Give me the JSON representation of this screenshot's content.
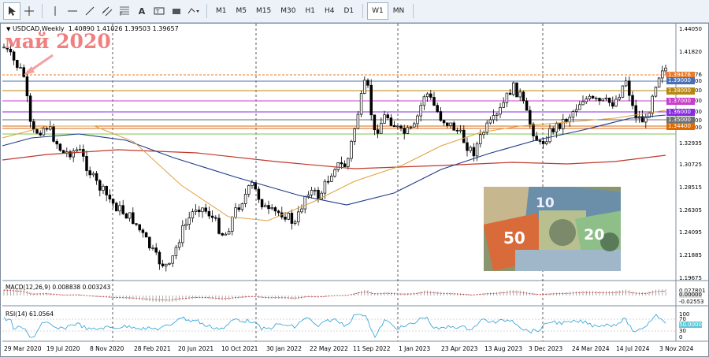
{
  "toolbar": {
    "timeframes": [
      "M1",
      "M5",
      "M15",
      "M30",
      "H1",
      "H4",
      "D1",
      "W1",
      "MN"
    ],
    "active_timeframe": "W1",
    "tool_icons": [
      "cursor-icon",
      "crosshair-icon",
      "vertical-line-icon",
      "horizontal-line-icon",
      "trendline-icon",
      "channel-icon",
      "fibonacci-icon",
      "text-icon",
      "label-icon",
      "rectangle-icon",
      "shapes-icon"
    ],
    "text_tool_label": "A"
  },
  "chart": {
    "symbol_line": "USDCAD,Weekly  1.40890 1.41026 1.39503 1.39657",
    "annotation": "май 2020",
    "price_axis": [
      "1.44050",
      "1.41820",
      "1.39476",
      "1.39000",
      "1.38000",
      "1.37000",
      "1.36000",
      "1.35000",
      "1.34400",
      "1.32935",
      "1.30725",
      "1.28515",
      "1.26305",
      "1.24095",
      "1.21885",
      "1.19675"
    ],
    "price_labels": [
      {
        "text": "1.39476",
        "color": "#e97c2a"
      },
      {
        "text": "1.39000",
        "color": "#4a6fb5"
      },
      {
        "text": "1.38000",
        "color": "#b8860b"
      },
      {
        "text": "1.37000",
        "color": "#c93fcb"
      },
      {
        "text": "1.36000",
        "color": "#8a2be2"
      },
      {
        "text": "1.35000",
        "color": "#707070"
      },
      {
        "text": "1.34400",
        "color": "#e06a00"
      }
    ],
    "date_axis": [
      "29 Mar 2020",
      "19 Jul 2020",
      "8 Nov 2020",
      "28 Feb 2021",
      "20 Jun 2021",
      "10 Oct 2021",
      "30 Jan 2022",
      "22 May 2022",
      "11 Sep 2022",
      "1 Jan 2023",
      "23 Apr 2023",
      "13 Aug 2023",
      "3 Dec 2023",
      "24 Mar 2024",
      "14 Jul 2024",
      "3 Nov 2024"
    ],
    "macd_label": "MACD(12,26,9) 0.008838 0.003243",
    "macd_axis": [
      "0.027801",
      "0.00000",
      "-0.02553"
    ],
    "rsi_label": "RSI(14) 61.0564",
    "rsi_axis": [
      "100",
      "70",
      "50.0000",
      "30",
      "0"
    ]
  }
}
